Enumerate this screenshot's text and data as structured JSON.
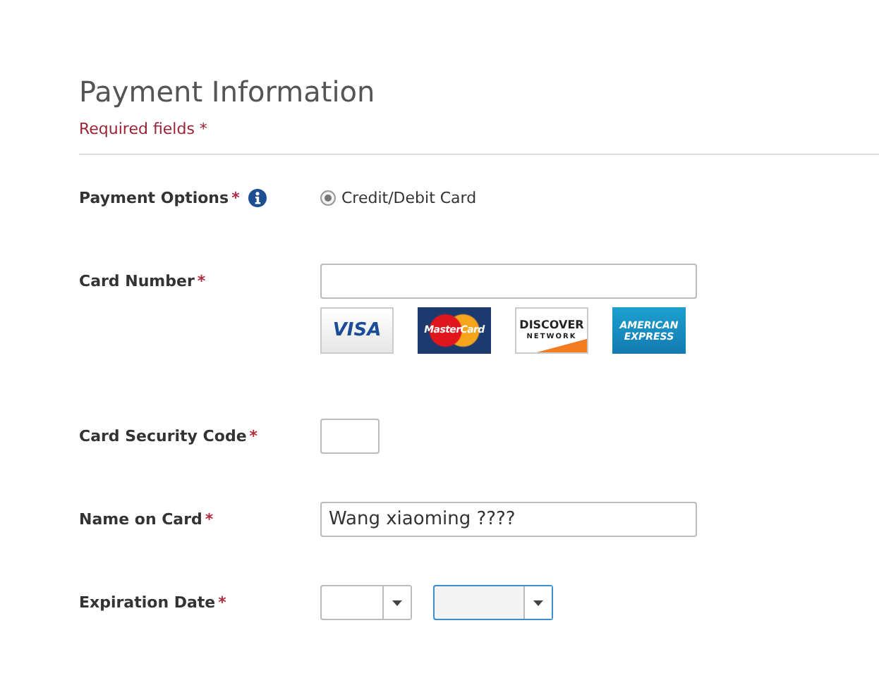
{
  "header": {
    "title": "Payment Information",
    "required_note": "Required fields *"
  },
  "rows": [
    {
      "kind": "options",
      "label": "Payment Options",
      "mark": "*",
      "info": true,
      "radios": [
        {
          "label": "Credit/Debit Card",
          "selected": true
        }
      ]
    },
    {
      "kind": "card",
      "label": "Card Number",
      "mark": "*",
      "cards": [
        {
          "kind": "visa",
          "lines": [
            "VISA"
          ]
        },
        {
          "kind": "mastercard",
          "lines": [
            "MasterCard"
          ]
        },
        {
          "kind": "discover",
          "lines": [
            "DISCOVER",
            "NETWORK"
          ]
        },
        {
          "kind": "amex",
          "lines": [
            "AMERICAN",
            "EXPRESS"
          ]
        }
      ]
    },
    {
      "kind": "short",
      "label": "Card Security Code",
      "mark": "*"
    },
    {
      "kind": "text",
      "label": "Name on Card",
      "mark": "*",
      "value": "Wang xiaoming ????"
    },
    {
      "kind": "dropdowns",
      "label": "Expiration Date",
      "mark": "*",
      "dropdowns": [
        {
          "focused": false
        },
        {
          "focused": true
        }
      ]
    }
  ]
}
